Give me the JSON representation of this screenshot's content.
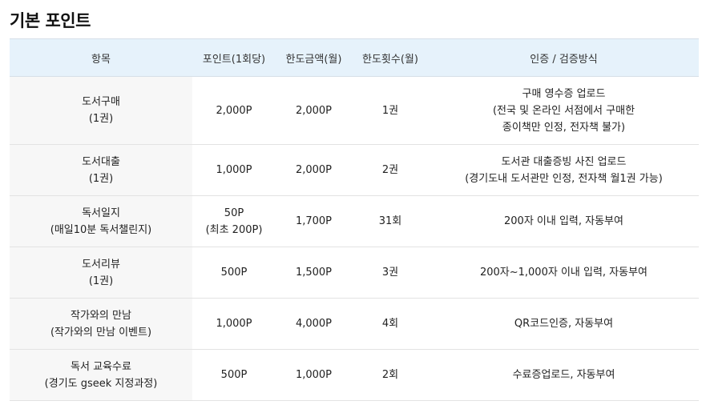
{
  "title": "기본 포인트",
  "table": {
    "headers": [
      "항목",
      "포인트(1회당)",
      "한도금액(월)",
      "한도횟수(월)",
      "인증 / 검증방식"
    ],
    "rows": [
      {
        "item": [
          "도서구매",
          "(1권)"
        ],
        "points": [
          "2,000P"
        ],
        "limit_amount": "2,000P",
        "limit_count": "1권",
        "method": [
          "구매 영수증 업로드",
          "(전국 및 온라인 서점에서 구매한",
          "종이책만 인정, 전자책 불가)"
        ]
      },
      {
        "item": [
          "도서대출",
          "(1권)"
        ],
        "points": [
          "1,000P"
        ],
        "limit_amount": "2,000P",
        "limit_count": "2권",
        "method": [
          "도서관 대출증빙 사진 업로드",
          "(경기도내 도서관만 인정, 전자책 월1권 가능)"
        ]
      },
      {
        "item": [
          "독서일지",
          "(매일10분 독서챌린지)"
        ],
        "points": [
          "50P",
          "(최초 200P)"
        ],
        "limit_amount": "1,700P",
        "limit_count": "31회",
        "method": [
          "200자 이내 입력, 자동부여"
        ]
      },
      {
        "item": [
          "도서리뷰",
          "(1권)"
        ],
        "points": [
          "500P"
        ],
        "limit_amount": "1,500P",
        "limit_count": "3권",
        "method": [
          "200자~1,000자 이내 입력, 자동부여"
        ]
      },
      {
        "item": [
          "작가와의 만남",
          "(작가와의 만남 이벤트)"
        ],
        "points": [
          "1,000P"
        ],
        "limit_amount": "4,000P",
        "limit_count": "4회",
        "method": [
          "QR코드인증, 자동부여"
        ]
      },
      {
        "item": [
          "독서 교육수료",
          "(경기도 gseek 지정과정)"
        ],
        "points": [
          "500P"
        ],
        "limit_amount": "1,000P",
        "limit_count": "2회",
        "method": [
          "수료증업로드, 자동부여"
        ]
      }
    ]
  }
}
